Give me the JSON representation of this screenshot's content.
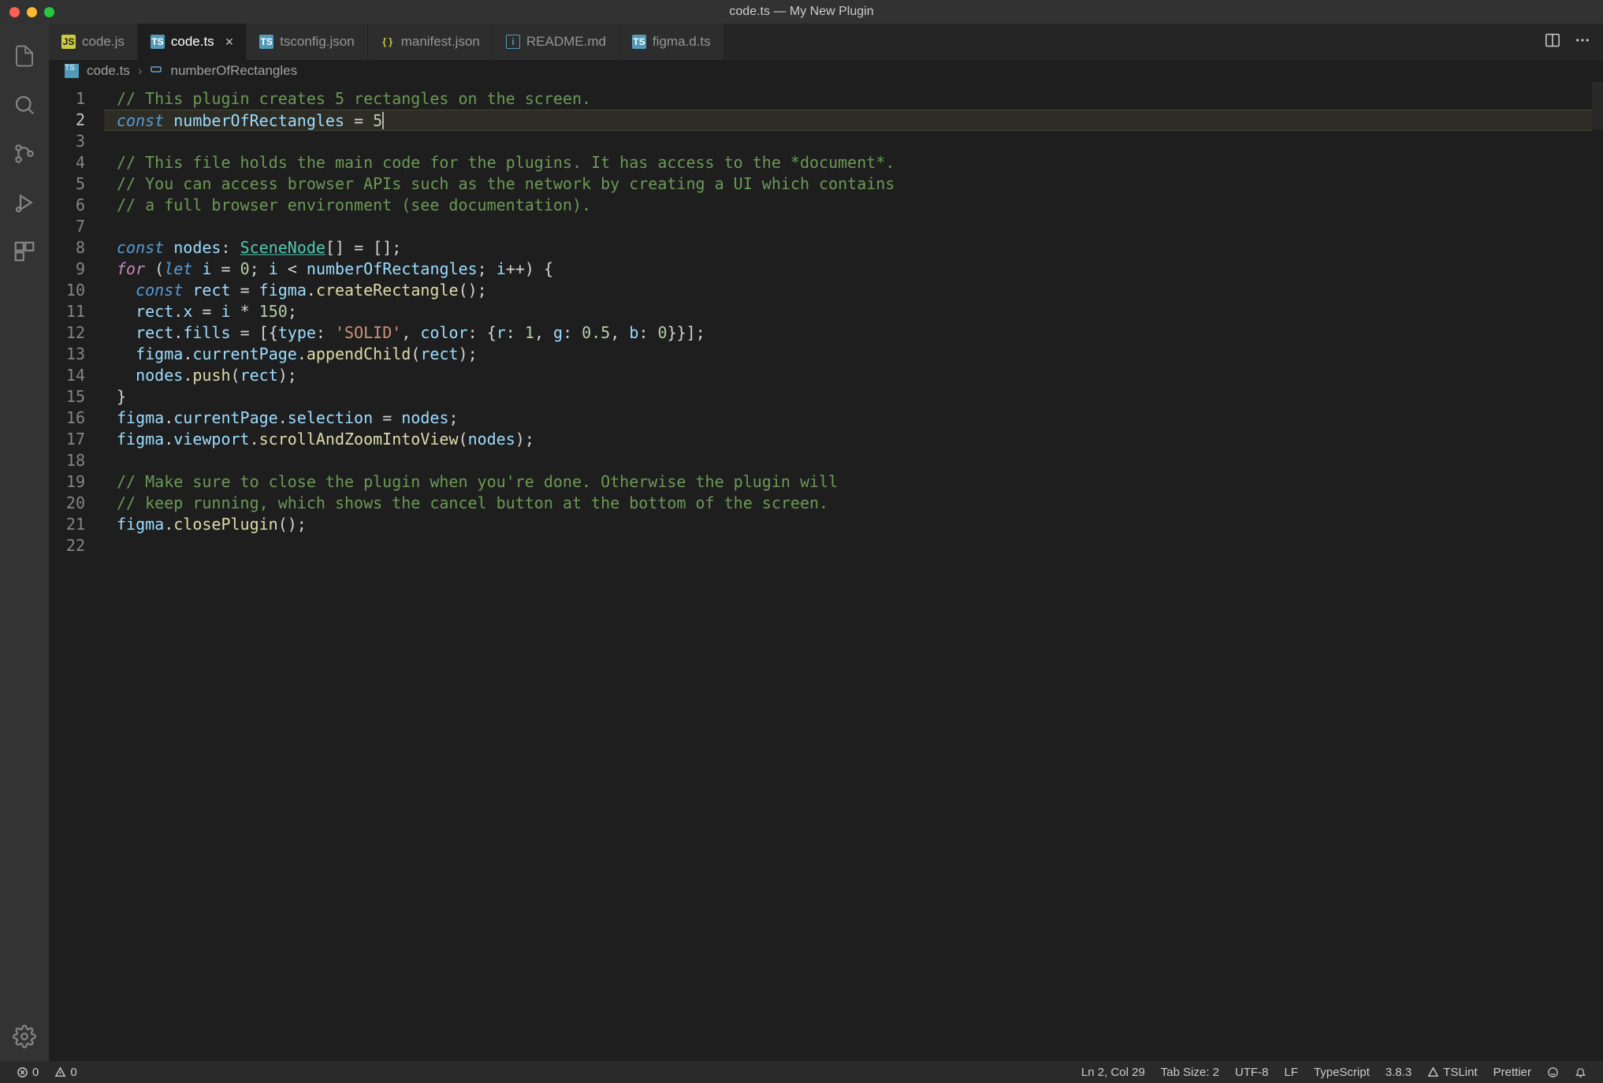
{
  "window": {
    "title": "code.ts — My New Plugin"
  },
  "tabs": [
    {
      "icon": "js",
      "label": "code.js"
    },
    {
      "icon": "ts",
      "label": "code.ts",
      "active": true,
      "close": true
    },
    {
      "icon": "ts",
      "label": "tsconfig.json"
    },
    {
      "icon": "json",
      "label": "manifest.json"
    },
    {
      "icon": "info",
      "label": "README.md"
    },
    {
      "icon": "ts",
      "label": "figma.d.ts"
    }
  ],
  "breadcrumb": {
    "file": "code.ts",
    "symbol": "numberOfRectangles"
  },
  "code": {
    "total_lines": 22,
    "current_line": 2,
    "lines_html": [
      "<span class='tok-comment'>// This plugin creates 5 rectangles on the screen.</span>",
      "<span class='tok-keyword2'>const</span> <span class='tok-var'>numberOfRectangles</span> <span class='tok-op'>=</span> <span class='tok-num'>5</span><span class='cursor'></span>",
      "",
      "<span class='tok-comment'>// This file holds the main code for the plugins. It has access to the *document*.</span>",
      "<span class='tok-comment'>// You can access browser APIs such as the network by creating a UI which contains</span>",
      "<span class='tok-comment'>// a full browser environment (see documentation).</span>",
      "",
      "<span class='tok-keyword2'>const</span> <span class='tok-var'>nodes</span><span class='tok-op'>:</span> <span class='tok-type'>SceneNode</span><span class='tok-op'>[] = [];</span>",
      "<span class='tok-keyword'>for</span> <span class='tok-op'>(</span><span class='tok-keyword2'>let</span> <span class='tok-var'>i</span> <span class='tok-op'>=</span> <span class='tok-num'>0</span><span class='tok-op'>;</span> <span class='tok-var'>i</span> <span class='tok-op'>&lt;</span> <span class='tok-var'>numberOfRectangles</span><span class='tok-op'>;</span> <span class='tok-var'>i</span><span class='tok-op'>++) {</span>",
      "  <span class='tok-keyword2'>const</span> <span class='tok-var'>rect</span> <span class='tok-op'>=</span> <span class='tok-var'>figma</span><span class='tok-op'>.</span><span class='tok-func'>createRectangle</span><span class='tok-op'>();</span>",
      "  <span class='tok-var'>rect</span><span class='tok-op'>.</span><span class='tok-prop'>x</span> <span class='tok-op'>=</span> <span class='tok-var'>i</span> <span class='tok-op'>*</span> <span class='tok-num'>150</span><span class='tok-op'>;</span>",
      "  <span class='tok-var'>rect</span><span class='tok-op'>.</span><span class='tok-prop'>fills</span> <span class='tok-op'>= [{</span><span class='tok-prop'>type</span><span class='tok-op'>:</span> <span class='tok-str'>'SOLID'</span><span class='tok-op'>,</span> <span class='tok-prop'>color</span><span class='tok-op'>: {</span><span class='tok-prop'>r</span><span class='tok-op'>:</span> <span class='tok-num'>1</span><span class='tok-op'>,</span> <span class='tok-prop'>g</span><span class='tok-op'>:</span> <span class='tok-num'>0.5</span><span class='tok-op'>,</span> <span class='tok-prop'>b</span><span class='tok-op'>:</span> <span class='tok-num'>0</span><span class='tok-op'>}}];</span>",
      "  <span class='tok-var'>figma</span><span class='tok-op'>.</span><span class='tok-prop'>currentPage</span><span class='tok-op'>.</span><span class='tok-func'>appendChild</span><span class='tok-op'>(</span><span class='tok-var'>rect</span><span class='tok-op'>);</span>",
      "  <span class='tok-var'>nodes</span><span class='tok-op'>.</span><span class='tok-func'>push</span><span class='tok-op'>(</span><span class='tok-var'>rect</span><span class='tok-op'>);</span>",
      "<span class='tok-op'>}</span>",
      "<span class='tok-var'>figma</span><span class='tok-op'>.</span><span class='tok-prop'>currentPage</span><span class='tok-op'>.</span><span class='tok-prop'>selection</span> <span class='tok-op'>=</span> <span class='tok-var'>nodes</span><span class='tok-op'>;</span>",
      "<span class='tok-var'>figma</span><span class='tok-op'>.</span><span class='tok-prop'>viewport</span><span class='tok-op'>.</span><span class='tok-func'>scrollAndZoomIntoView</span><span class='tok-op'>(</span><span class='tok-var'>nodes</span><span class='tok-op'>);</span>",
      "",
      "<span class='tok-comment'>// Make sure to close the plugin when you're done. Otherwise the plugin will</span>",
      "<span class='tok-comment'>// keep running, which shows the cancel button at the bottom of the screen.</span>",
      "<span class='tok-var'>figma</span><span class='tok-op'>.</span><span class='tok-func'>closePlugin</span><span class='tok-op'>();</span>",
      ""
    ]
  },
  "statusbar": {
    "errors": "0",
    "warnings": "0",
    "cursor": "Ln 2, Col 29",
    "tabsize": "Tab Size: 2",
    "encoding": "UTF-8",
    "eol": "LF",
    "language": "TypeScript",
    "version": "3.8.3",
    "tslint": "TSLint",
    "prettier": "Prettier"
  }
}
